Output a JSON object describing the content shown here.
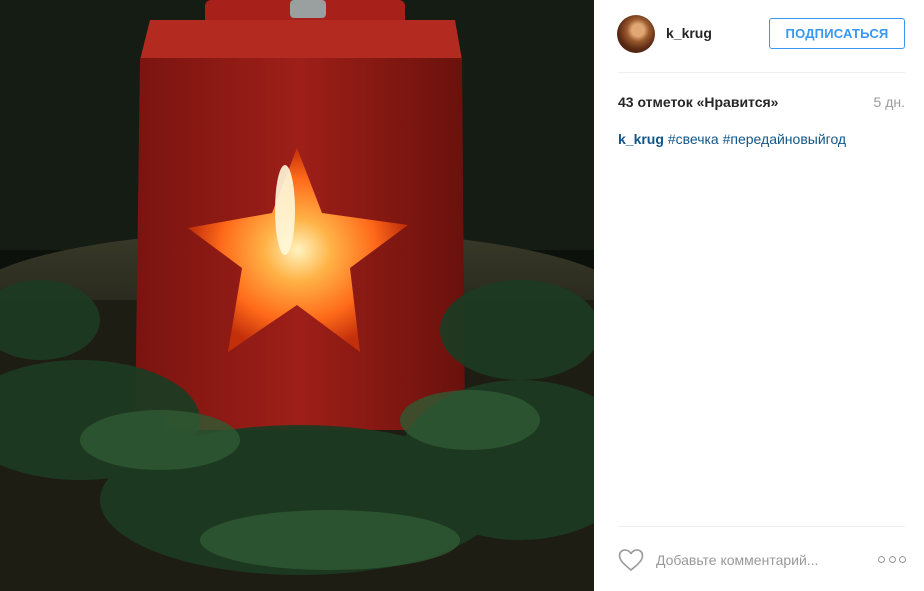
{
  "post": {
    "photo_description": "",
    "author": {
      "username": "k_krug"
    },
    "follow_label": "ПОДПИСАТЬСЯ",
    "likes_text": "43 отметок «Нравится»",
    "time_text": "5 дн.",
    "caption": {
      "username": "k_krug",
      "tags": [
        "#свечка",
        "#передайновыйгод"
      ]
    },
    "comment": {
      "placeholder": "Добавьте комментарий..."
    },
    "icons": {
      "like": "heart-icon",
      "more": "more-options-icon"
    },
    "colors": {
      "accent": "#3897f0",
      "link": "#125688",
      "text": "#262626",
      "muted": "#999999"
    }
  }
}
